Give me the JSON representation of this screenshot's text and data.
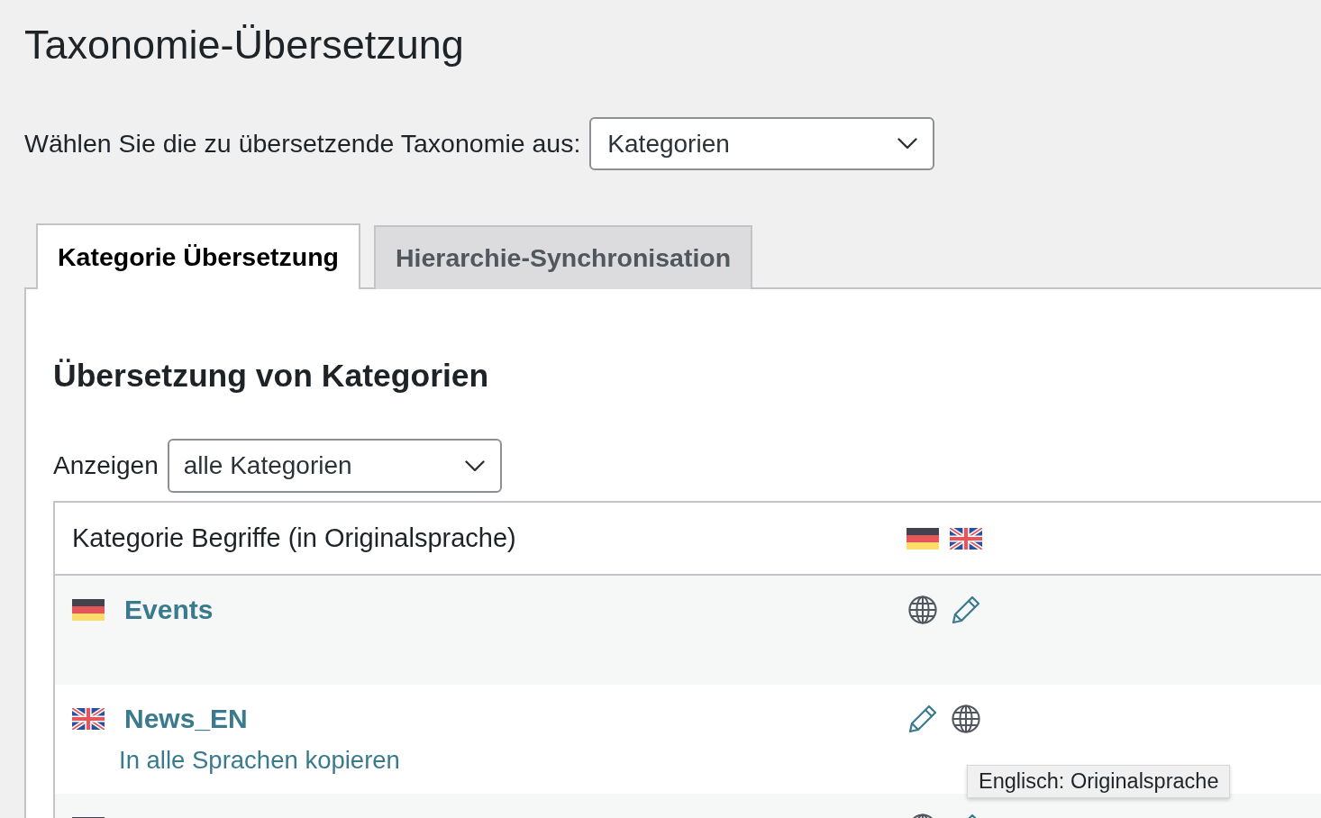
{
  "page": {
    "title": "Taxonomie-Übersetzung"
  },
  "taxonomy_select": {
    "label": "Wählen Sie die zu übersetzende Taxonomie aus:",
    "value": "Kategorien"
  },
  "tabs": [
    {
      "label": "Kategorie Übersetzung",
      "selected": true
    },
    {
      "label": "Hierarchie-Synchronisation",
      "selected": false
    }
  ],
  "section": {
    "title": "Übersetzung von Kategorien"
  },
  "filter": {
    "label": "Anzeigen",
    "value": "alle Kategorien"
  },
  "table": {
    "column_1": "Kategorie Begriffe (in Originalsprache)",
    "languages": [
      {
        "kind": "german"
      },
      {
        "kind": "british"
      }
    ],
    "rows": [
      {
        "flag": {
          "kind": "german"
        },
        "name": "Events",
        "actions": [
          {
            "kind": "original"
          },
          {
            "kind": "edit"
          }
        ]
      },
      {
        "flag": {
          "kind": "british"
        },
        "name": "News_EN",
        "link": "In alle Sprachen kopieren",
        "actions": [
          {
            "kind": "edit"
          },
          {
            "kind": "original"
          }
        ]
      },
      {
        "flag": {
          "kind": "german"
        },
        "actions": [
          {
            "kind": "original"
          },
          {
            "kind": "edit"
          }
        ]
      }
    ]
  },
  "tooltip": {
    "text": "Englisch: Originalsprache"
  }
}
